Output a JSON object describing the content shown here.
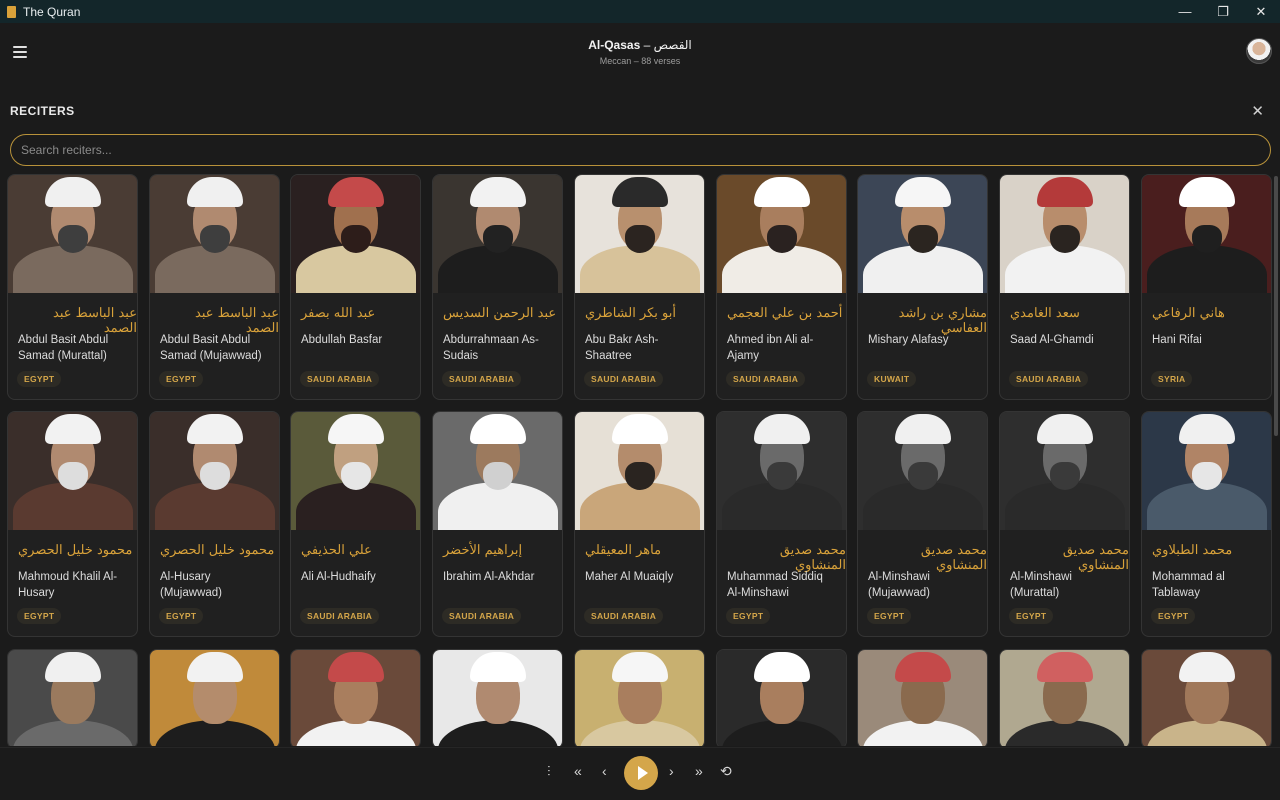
{
  "window": {
    "title": "The Quran",
    "minimize": "—",
    "restore": "❐",
    "close": "✕"
  },
  "header": {
    "surah_name": "Al-Qasas",
    "surah_sep": " – ",
    "surah_arabic": "القصص",
    "surah_info": "Meccan – 88 verses"
  },
  "panel": {
    "title": "RECITERS",
    "close": "✕",
    "search_placeholder": "Search reciters..."
  },
  "reciters": [
    {
      "arabic": "عبد الباسط عبد الصمد",
      "name": "Abdul Basit Abdul Samad (Murattal)",
      "country": "EGYPT"
    },
    {
      "arabic": "عبد الباسط عبد الصمد",
      "name": "Abdul Basit Abdul Samad (Mujawwad)",
      "country": "EGYPT"
    },
    {
      "arabic": "عبد الله بصفر",
      "name": "Abdullah Basfar",
      "country": "SAUDI ARABIA"
    },
    {
      "arabic": "عبد الرحمن السديس",
      "name": "Abdurrahmaan As-Sudais",
      "country": "SAUDI ARABIA"
    },
    {
      "arabic": "أبو بكر الشاطري",
      "name": "Abu Bakr Ash-Shaatree",
      "country": "SAUDI ARABIA"
    },
    {
      "arabic": "أحمد بن علي العجمي",
      "name": "Ahmed ibn Ali al-Ajamy",
      "country": "SAUDI ARABIA"
    },
    {
      "arabic": "مشاري بن راشد العفاسي",
      "name": "Mishary Alafasy",
      "country": "KUWAIT"
    },
    {
      "arabic": "سعد الغامدي",
      "name": "Saad Al-Ghamdi",
      "country": "SAUDI ARABIA"
    },
    {
      "arabic": "هاني الرفاعي",
      "name": "Hani Rifai",
      "country": "SYRIA"
    },
    {
      "arabic": "محمود خليل الحصري",
      "name": "Mahmoud Khalil Al-Husary",
      "country": "EGYPT"
    },
    {
      "arabic": "محمود خليل الحصري",
      "name": "Al-Husary (Mujawwad)",
      "country": "EGYPT"
    },
    {
      "arabic": "علي الحذيفي",
      "name": "Ali Al-Hudhaify",
      "country": "SAUDI ARABIA"
    },
    {
      "arabic": "إبراهيم الأخضر",
      "name": "Ibrahim Al-Akhdar",
      "country": "SAUDI ARABIA"
    },
    {
      "arabic": "ماهر المعيقلي",
      "name": "Maher Al Muaiqly",
      "country": "SAUDI ARABIA"
    },
    {
      "arabic": "محمد صديق المنشاوي",
      "name": "Muhammad Siddiq Al-Minshawi",
      "country": "EGYPT"
    },
    {
      "arabic": "محمد صديق المنشاوي",
      "name": "Al-Minshawi (Mujawwad)",
      "country": "EGYPT"
    },
    {
      "arabic": "محمد صديق المنشاوي",
      "name": "Al-Minshawi (Murattal)",
      "country": "EGYPT"
    },
    {
      "arabic": "محمد الطبلاوي",
      "name": "Mohammad al Tablaway",
      "country": "EGYPT"
    }
  ],
  "player": {
    "equalizer": "⫶",
    "rewind": "«",
    "prev": "‹",
    "next": "›",
    "forward": "»",
    "repeat": "⟲"
  }
}
